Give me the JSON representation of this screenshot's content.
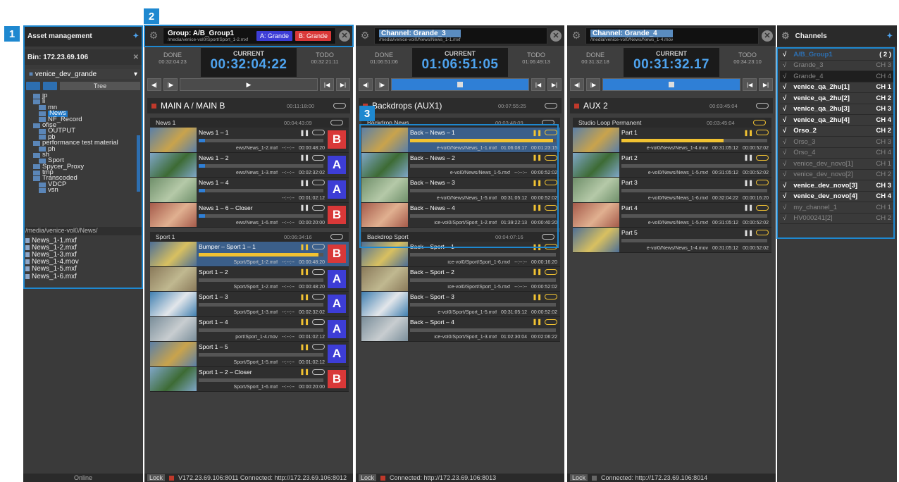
{
  "callouts": [
    "1",
    "2",
    "3"
  ],
  "asset": {
    "title": "Asset management",
    "bin": "Bin: 172.23.69.106",
    "dropdown": "venice_dev_grande",
    "tree_label": "Tree",
    "tree": [
      "jp",
      "li",
      "mn",
      "News",
      "NF_Record",
      "ofise",
      "OUTPUT",
      "pb",
      "performance test material",
      "ph",
      "sh",
      "Sport",
      "Spycer_Proxy",
      "tmp",
      "Transcoded",
      "VDCP",
      "vsn"
    ],
    "path": "/media/venice-vol0/News/",
    "files": [
      "News_1-1.mxf",
      "News_1-2.mxf",
      "News_1-3.mxf",
      "News_1-4.mov",
      "News_1-5.mxf",
      "News_1-6.mxf"
    ],
    "status": "Online"
  },
  "ch1": {
    "title": "Group: A/B_Group1",
    "path": "/media/venice-vol0/Sport/Sport_1-2.mxf",
    "badge_a": "A: Grande",
    "badge_b": "B: Grande",
    "done_label": "DONE",
    "done": "00:32:04:23",
    "current_label": "CURRENT",
    "current": "00:32:04:22",
    "todo_label": "TODO",
    "todo": "00:32:21:11",
    "section": "MAIN A / MAIN B",
    "section_time": "00:11:18:00",
    "groups": [
      {
        "name": "News 1",
        "time": "00:04:43:09",
        "items": [
          {
            "name": "News 1 – 1",
            "path": "ews/News_1-2.mxf",
            "t1": "--:--:--",
            "t2": "00:00:48:20",
            "ab": "B",
            "fill": 0.05
          },
          {
            "name": "News 1 – 2",
            "path": "ews/News_1-3.mxf",
            "t1": "--:--:--",
            "t2": "00:02:32:02",
            "ab": "A",
            "fill": 0.05
          },
          {
            "name": "News 1 – 4",
            "path": "",
            "t1": "--:--:--",
            "t2": "00:01:02:12",
            "ab": "A",
            "fill": 0.05
          },
          {
            "name": "News 1 – 6 – Closer",
            "path": "ews/News_1-6.mxf",
            "t1": "--:--:--",
            "t2": "00:00:20:00",
            "ab": "B",
            "fill": 0.05
          }
        ]
      },
      {
        "name": "Sport 1",
        "time": "00:06:34:16",
        "items": [
          {
            "name": "Bumper – Sport 1 – 1",
            "path": "Sport/Sport_1-2.mxf",
            "t1": "--:--:--",
            "t2": "00:00:48:20",
            "ab": "B",
            "fill": 0.96,
            "active": true
          },
          {
            "name": "Sport 1 – 2",
            "path": "Sport/Sport_1-2.mxf",
            "t1": "--:--:--",
            "t2": "00:00:48:20",
            "ab": "A",
            "fill": 0
          },
          {
            "name": "Sport 1 – 3",
            "path": "Sport/Sport_1-3.mxf",
            "t1": "--:--:--",
            "t2": "00:02:32:02",
            "ab": "A",
            "fill": 0
          },
          {
            "name": "Sport 1 – 4",
            "path": "port/Sport_1-4.mov",
            "t1": "--:--:--",
            "t2": "00:01:02:12",
            "ab": "A",
            "fill": 0
          },
          {
            "name": "Sport 1 – 5",
            "path": "Sport/Sport_1-5.mxf",
            "t1": "--:--:--",
            "t2": "00:01:02:12",
            "ab": "A",
            "fill": 0
          },
          {
            "name": "Sport 1 – 2 – Closer",
            "path": "Sport/Sport_1-6.mxf",
            "t1": "--:--:--",
            "t2": "00:00:20:00",
            "ab": "B",
            "fill": 0
          }
        ]
      }
    ],
    "status": "V172.23.69.106:8011 Connected: http://172.23.69.106:8012"
  },
  "ch2": {
    "title": "Channel: Grande_3",
    "path": "/media/venice-vol0/News/News_1-1.mxf",
    "done_label": "DONE",
    "done": "01:06:51:06",
    "current_label": "CURRENT",
    "current": "01:06:51:05",
    "todo_label": "TODO",
    "todo": "01:06:49:13",
    "section": "Backdrops (AUX1)",
    "section_time": "00:07:55:25",
    "groups": [
      {
        "name": "Backdrop News",
        "time": "00:03:48:09",
        "items": [
          {
            "name": "Back – News – 1",
            "path": "e-vol0/News/News_1-1.mxf",
            "t1": "01:06:08:17",
            "t2": "00:01:23:15",
            "fill": 0.98,
            "active": true
          },
          {
            "name": "Back – News – 2",
            "path": "e-vol0/News/News_1-5.mxf",
            "t1": "--:--:--",
            "t2": "00:00:52:02",
            "fill": 0
          },
          {
            "name": "Back – News – 3",
            "path": "e-vol0/News/News_1-5.mxf",
            "t1": "00:31:05:12",
            "t2": "00:00:52:02",
            "fill": 0
          },
          {
            "name": "Back – News – 4",
            "path": "ice-vol0/Sport/Sport_1-2.mxf",
            "t1": "01:39:22:13",
            "t2": "00:00:40:20",
            "fill": 0
          }
        ]
      },
      {
        "name": "Backdrop Sport",
        "time": "00:04:07:16",
        "items": [
          {
            "name": "Back – Sport – 1",
            "path": "ice-vol0/Sport/Sport_1-6.mxf",
            "t1": "--:--:--",
            "t2": "00:00:16:20",
            "fill": 0
          },
          {
            "name": "Back – Sport – 2",
            "path": "ice-vol0/Sport/Sport_1-5.mxf",
            "t1": "--:--:--",
            "t2": "00:00:52:02",
            "fill": 0
          },
          {
            "name": "Back – Sport – 3",
            "path": "e-vol0/Sport/Sport_1-5.mxf",
            "t1": "00:31:05:12",
            "t2": "00:00:52:02",
            "fill": 0
          },
          {
            "name": "Back – Sport – 4",
            "path": "ice-vol0/Sport/Sport_1-3.mxf",
            "t1": "01:02:30:04",
            "t2": "00:02:06:22",
            "fill": 0
          }
        ]
      }
    ],
    "status": "Connected: http://172.23.69.106:8013"
  },
  "ch3": {
    "title": "Channel: Grande_4",
    "path": "/media/venice-vol0/News/News_1-4.mov",
    "done_label": "DONE",
    "done": "00:31:32:18",
    "current_label": "CURRENT",
    "current": "00:31:32.17",
    "todo_label": "TODO",
    "todo": "00:34:23:10",
    "section": "AUX 2",
    "section_time": "00:03:45:04",
    "groups": [
      {
        "name": "Studio Loop Permanent",
        "time": "00:03:45:04",
        "items": [
          {
            "name": "Part 1",
            "path": "e-vol0/News/News_1-4.mov",
            "t1": "00:31:05:12",
            "t2": "00:00:52:02",
            "fill": 0.7,
            "yfill": true
          },
          {
            "name": "Part 2",
            "path": "e-vol0/News/News_1-5.mxf",
            "t1": "00:31:05:12",
            "t2": "00:00:52:02",
            "fill": 0
          },
          {
            "name": "Part 3",
            "path": "e-vol0/News/News_1-6.mxf",
            "t1": "00:32:04:22",
            "t2": "00:00:16:20",
            "fill": 0
          },
          {
            "name": "Part 4",
            "path": "e-vol0/News/News_1-5.mxf",
            "t1": "00:31:05:12",
            "t2": "00:00:52:02",
            "fill": 0
          },
          {
            "name": "Part 5",
            "path": "e-vol0/News/News_1-4.mov",
            "t1": "00:31:05:12",
            "t2": "00:00:52:02",
            "fill": 0
          }
        ]
      }
    ],
    "status": "Connected: http://172.23.69.106:8014"
  },
  "channels": {
    "title": "Channels",
    "rows": [
      {
        "name": "A/B_Group1",
        "ch": "( 2 )",
        "state": "grp"
      },
      {
        "name": "Grande_3",
        "ch": "CH 3",
        "state": "off"
      },
      {
        "name": "Grande_4",
        "ch": "CH 4",
        "state": "off"
      },
      {
        "name": "venice_qa_2hu[1]",
        "ch": "CH 1",
        "state": "on"
      },
      {
        "name": "venice_qa_2hu[2]",
        "ch": "CH 2",
        "state": "on"
      },
      {
        "name": "venice_qa_2hu[3]",
        "ch": "CH 3",
        "state": "on"
      },
      {
        "name": "venice_qa_2hu[4]",
        "ch": "CH 4",
        "state": "on"
      },
      {
        "name": "Orso_2",
        "ch": "CH 2",
        "state": "on"
      },
      {
        "name": "Orso_3",
        "ch": "CH 3",
        "state": "off"
      },
      {
        "name": "Orso_4",
        "ch": "CH 4",
        "state": "off"
      },
      {
        "name": "venice_dev_novo[1]",
        "ch": "CH 1",
        "state": "off"
      },
      {
        "name": "venice_dev_novo[2]",
        "ch": "CH 2",
        "state": "off"
      },
      {
        "name": "venice_dev_novo[3]",
        "ch": "CH 3",
        "state": "on"
      },
      {
        "name": "venice_dev_novo[4]",
        "ch": "CH 4",
        "state": "on"
      },
      {
        "name": "my_channel_1",
        "ch": "CH 1",
        "state": "off"
      },
      {
        "name": "HV000241[2]",
        "ch": "CH 2",
        "state": "off"
      }
    ]
  },
  "lock_label": "Lock",
  "colors": {
    "accent": "#1e88d0",
    "a": "#3d3dd6",
    "b": "#d93838",
    "yellow": "#f1c232",
    "timer": "#4ea3ee"
  }
}
